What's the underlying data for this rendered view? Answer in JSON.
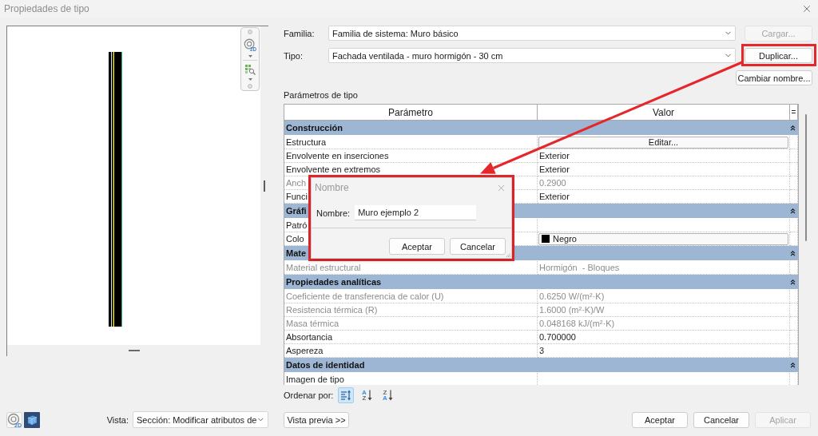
{
  "window": {
    "title": "Propiedades de tipo"
  },
  "preview": {
    "nav_badge": "2D",
    "tools": [
      {
        "kind": "wheel",
        "badge": "2D"
      },
      {
        "kind": "cube"
      }
    ],
    "view_label": "Vista:",
    "view_value": "Sección: Modificar atributos de",
    "preview_button": "Vista previa >>"
  },
  "family": {
    "label": "Familia:",
    "value": "Familia de sistema: Muro básico",
    "button": {
      "label": "Cargar...",
      "disabled": true
    }
  },
  "type": {
    "label": "Tipo:",
    "value": "Fachada ventilada - muro hormigón - 30 cm",
    "button": {
      "label": "Duplicar...",
      "disabled": false,
      "highlighted": true
    },
    "rename_button": {
      "label": "Cambiar nombre...",
      "disabled": false
    }
  },
  "parameters": {
    "title": "Parámetros de tipo",
    "columns": [
      "Parámetro",
      "Valor",
      "="
    ],
    "rows": [
      {
        "kind": "group",
        "label": "Construcción",
        "expanded": true
      },
      {
        "kind": "button",
        "label": "Estructura",
        "value": "Editar...",
        "disabled": false
      },
      {
        "kind": "text",
        "label": "Envolvente en inserciones",
        "value": "Exterior",
        "disabled": false
      },
      {
        "kind": "text",
        "label": "Envolvente en extremos",
        "value": "Exterior",
        "disabled": false
      },
      {
        "kind": "text",
        "label": "Anch",
        "value": "0.2900",
        "disabled": true
      },
      {
        "kind": "text",
        "label": "Funci",
        "value": "Exterior",
        "disabled": false
      },
      {
        "kind": "group",
        "label": "Gráfi",
        "expanded": true
      },
      {
        "kind": "text",
        "label": "Patró",
        "disabled": false
      },
      {
        "kind": "color",
        "label": "Colo",
        "value": "Negro",
        "color": "#000000",
        "disabled": false
      },
      {
        "kind": "group",
        "label": "Mate",
        "expanded": true
      },
      {
        "kind": "text",
        "label": "Material estructural",
        "value": "Hormigón  - Bloques",
        "disabled": true
      },
      {
        "kind": "group",
        "label": "Propiedades analíticas",
        "expanded": true
      },
      {
        "kind": "text",
        "label": "Coeficiente de transferencia de calor (U)",
        "value": "0.6250 W/(m²·K)",
        "disabled": true
      },
      {
        "kind": "text",
        "label": "Resistencia térmica (R)",
        "value": "1.6000 (m²·K)/W",
        "disabled": true
      },
      {
        "kind": "text",
        "label": "Masa térmica",
        "value": "0.048168 kJ/(m²·K)",
        "disabled": true
      },
      {
        "kind": "text",
        "label": "Absortancia",
        "value": "0.700000",
        "disabled": false
      },
      {
        "kind": "text",
        "label": "Aspereza",
        "value": "3",
        "disabled": false
      },
      {
        "kind": "group",
        "label": "Datos de identidad",
        "expanded": true
      },
      {
        "kind": "text",
        "label": "Imagen de tipo",
        "disabled": false
      }
    ]
  },
  "sort": {
    "label": "Ordenar por:",
    "options": [
      {
        "kind": "grouped",
        "selected": true
      },
      {
        "kind": "alpha",
        "top": "A",
        "bottom": "Z",
        "accent_top": true,
        "selected": false
      },
      {
        "kind": "alpha",
        "top": "Z",
        "bottom": "A",
        "accent_top": false,
        "selected": false
      }
    ]
  },
  "buttons": [
    {
      "label": "Aceptar",
      "disabled": false
    },
    {
      "label": "Cancelar",
      "disabled": false
    },
    {
      "label": "Aplicar",
      "disabled": true
    }
  ],
  "dialog": {
    "title": "Nombre",
    "field_label": "Nombre:",
    "value": "Muro ejemplo 2",
    "buttons": [
      "Aceptar",
      "Cancelar"
    ],
    "highlighted": true
  },
  "annotation": {
    "arrow": true
  }
}
